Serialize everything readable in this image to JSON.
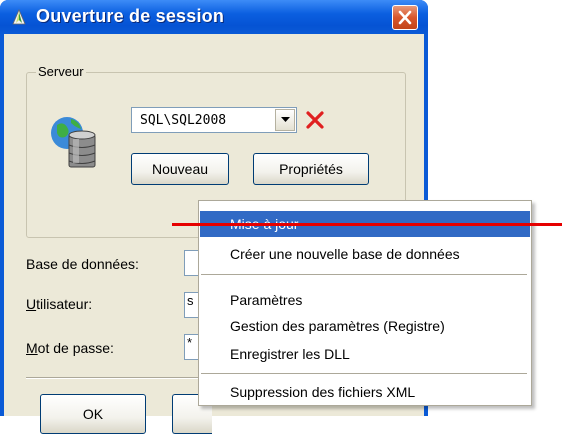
{
  "window": {
    "title": "Ouverture de session",
    "title_icon": "quill-icon",
    "close_icon": "close-icon"
  },
  "server_group": {
    "legend": "Serveur",
    "icon": "database-globe-icon",
    "selected_server": "SQL\\SQL2008",
    "dropdown_icon": "chevron-down-icon",
    "delete_icon": "red-x-icon",
    "new_label": "Nouveau",
    "properties_label": "Propriétés"
  },
  "fields": {
    "database_label": "Base de données:",
    "user_label": "Utilisateur:",
    "user_label_underlined": "U",
    "user_label_rest": "tilisateur:",
    "user_value": "s",
    "password_label": "Mot de passe:",
    "password_label_underlined": "M",
    "password_label_rest": "ot de passe:",
    "password_value": "*"
  },
  "buttons": {
    "ok_label": "OK"
  },
  "context_menu": {
    "items": [
      {
        "label": "Mise à jour",
        "highlighted": true
      },
      {
        "label": "Créer une nouvelle base de données"
      },
      {
        "label": "Paramètres"
      },
      {
        "label": "Gestion des paramètres (Registre)"
      },
      {
        "label": "Enregistrer les DLL"
      },
      {
        "label": "Suppression des fichiers XML"
      }
    ]
  },
  "colors": {
    "titlebar": "#0b5fe0",
    "dialog_background": "#ece9d8",
    "menu_highlight": "#316ac5",
    "annotation": "#e60000",
    "close_button": "#d8562c"
  }
}
